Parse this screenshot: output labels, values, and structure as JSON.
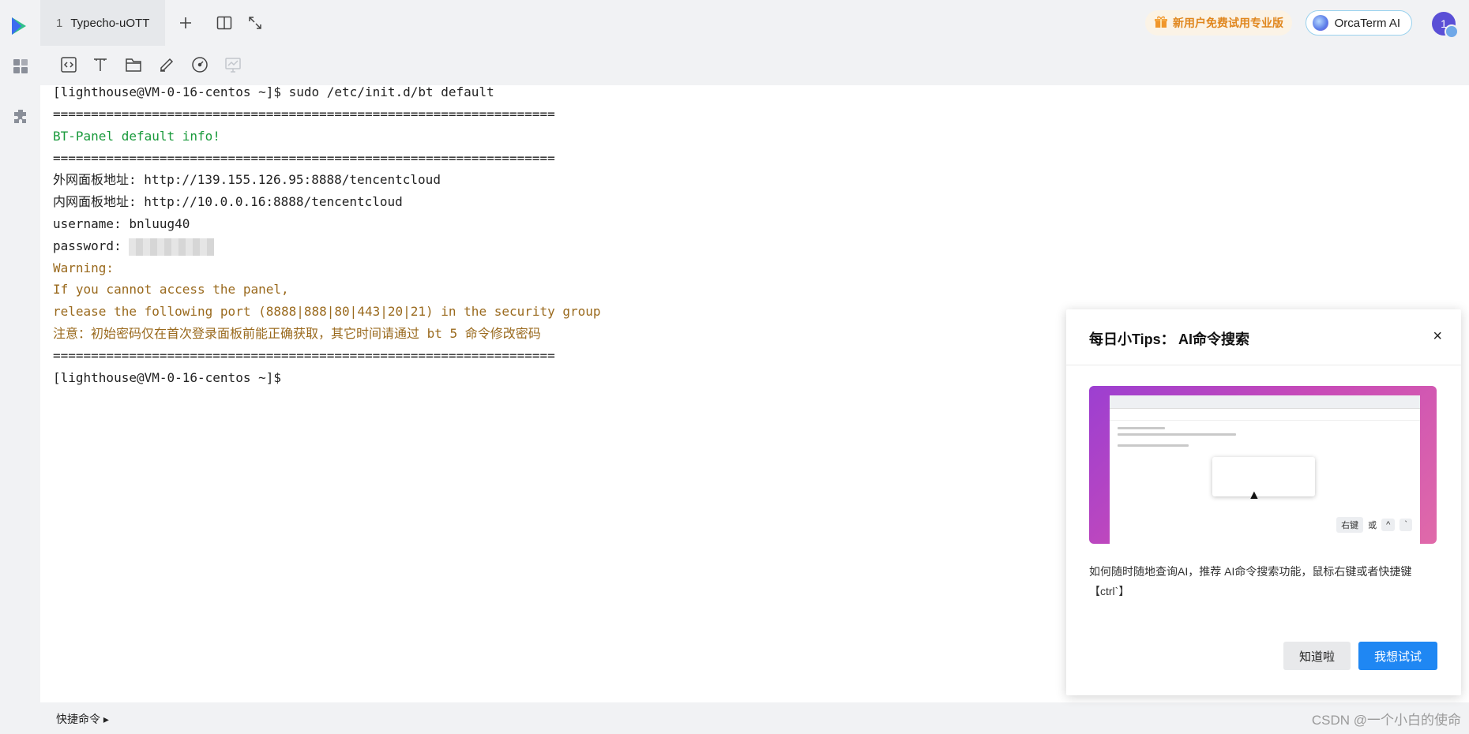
{
  "tabs": [
    {
      "index": "1",
      "label": "Typecho-uOTT"
    }
  ],
  "header": {
    "promo_label": "新用户免费试用专业版",
    "orca_label": "OrcaTerm AI",
    "avatar_text": "1"
  },
  "terminal": {
    "lines": [
      "[lighthouse@VM-0-16-centos ~]$ sudo /etc/init.d/bt default",
      "==================================================================",
      "BT-Panel default info!",
      "==================================================================",
      "外网面板地址: http://139.155.126.95:8888/tencentcloud",
      "内网面板地址: http://10.0.0.16:8888/tencentcloud",
      "username: bnluug40",
      "password: ",
      "Warning:",
      "If you cannot access the panel,",
      "release the following port (8888|888|80|443|20|21) in the security group",
      "注意：初始密码仅在首次登录面板前能正确获取，其它时间请通过 bt 5 命令修改密码",
      "==================================================================",
      "[lighthouse@VM-0-16-centos ~]$"
    ]
  },
  "bottom": {
    "quick_label": "快捷命令 ▸",
    "watermark": "CSDN @一个小白的使命"
  },
  "tips": {
    "title": "每日小Tips： AI命令搜索",
    "close": "×",
    "description": "如何随时随地查询AI，推荐 AI命令搜索功能，鼠标右键或者快捷键【ctrl`】",
    "preview_keys": [
      "右键",
      "或",
      "^",
      "`"
    ],
    "btn_dismiss": "知道啦",
    "btn_try": "我想试试"
  },
  "colors": {
    "accent": "#1f87f3",
    "terminal_green": "#1a9a3c",
    "terminal_warning": "#9a6a1e",
    "promo": "#e0861d"
  }
}
